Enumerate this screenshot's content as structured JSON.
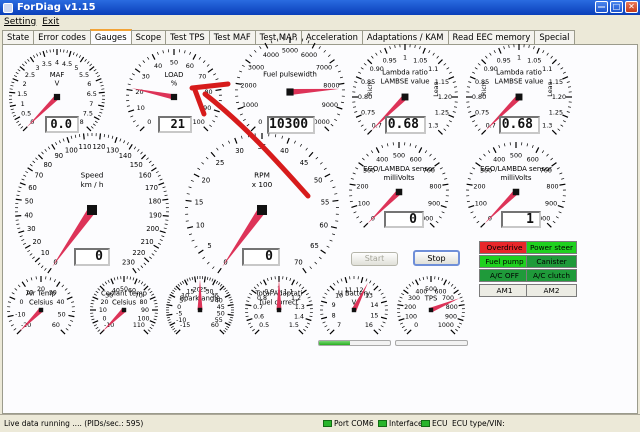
{
  "window": {
    "title": "ForDiag v1.15"
  },
  "menu": [
    "Setting",
    "Exit"
  ],
  "tabs": [
    "State",
    "Error codes",
    "Gauges",
    "Scope",
    "Test TPS",
    "Test MAF",
    "Test MAP",
    "Acceleration",
    "Adaptations / KAM",
    "Read EEC memory",
    "Special"
  ],
  "active_tab": "Gauges",
  "colors": {
    "needle": "#dd3358",
    "tab_accent": "#f2a336",
    "led_on": "#29b52b",
    "annotation_arrow": "#d71b1b"
  },
  "gauges": [
    {
      "title": [
        "MAF",
        "V"
      ],
      "labels": [
        "0",
        "0.5",
        "1",
        "1.5",
        "2",
        "2.5",
        "3",
        "3.5",
        "4",
        "4.5",
        "5",
        "5.5",
        "6",
        "6.5",
        "7",
        "7.5",
        "8"
      ],
      "readout": "0.0",
      "level": 0.0
    },
    {
      "title": [
        "LOAD",
        "%"
      ],
      "labels": [
        "0",
        "10",
        "20",
        "30",
        "40",
        "50",
        "60",
        "70",
        "80",
        "90",
        "100"
      ],
      "readout": "21",
      "level": 0.21
    },
    {
      "title": [
        "Fuel pulsewidth"
      ],
      "labels": [
        "0",
        "1000",
        "2000",
        "3000",
        "4000",
        "5000",
        "6000",
        "7000",
        "8000",
        "9000",
        "10000"
      ],
      "readout": "10300",
      "level": 0.82
    },
    {
      "title": [
        "Lambda ratio",
        "LAMBSE value"
      ],
      "labels": [
        "0.7",
        "0.75",
        "0.80",
        "0.85",
        "0.90",
        "0.95",
        "1",
        "1.05",
        "1.1",
        "1.15",
        "1.20",
        "1.25",
        "1.3"
      ],
      "side_left": "Rich",
      "side_right": "Lean",
      "readout": "0.68",
      "level": 0.0
    },
    {
      "title": [
        "Lambda ratio",
        "LAMBSE value"
      ],
      "labels": [
        "0.7",
        "0.75",
        "0.80",
        "0.85",
        "0.90",
        "0.95",
        "1",
        "1.05",
        "1.1",
        "1.15",
        "1.20",
        "1.25",
        "1.3"
      ],
      "side_left": "Rich",
      "side_right": "Lean",
      "readout": "0.68",
      "level": 0.0
    },
    {
      "title": [
        "Speed",
        "km / h"
      ],
      "labels": [
        "0",
        "10",
        "20",
        "30",
        "40",
        "50",
        "60",
        "70",
        "80",
        "90",
        "100",
        "110",
        "120",
        "130",
        "140",
        "150",
        "160",
        "170",
        "180",
        "190",
        "200",
        "210",
        "220",
        "230"
      ],
      "readout": "0",
      "level": 0.0
    },
    {
      "title": [
        "RPM",
        "x 100"
      ],
      "labels": [
        "0",
        "5",
        "10",
        "15",
        "20",
        "25",
        "30",
        "35",
        "40",
        "45",
        "50",
        "55",
        "60",
        "65",
        "70"
      ],
      "readout": "0",
      "level": 0.0
    },
    {
      "title": [
        "EGO/LAMBDA sensor",
        "milliVolts"
      ],
      "labels": [
        "0",
        "100",
        "200",
        "300",
        "400",
        "500",
        "600",
        "700",
        "800",
        "900",
        "1000"
      ],
      "readout": "0",
      "level": 0.0
    },
    {
      "title": [
        "EGO/LAMBDA sensor",
        "milliVolts"
      ],
      "labels": [
        "0",
        "100",
        "200",
        "300",
        "400",
        "500",
        "600",
        "700",
        "800",
        "900",
        "1000"
      ],
      "readout": "1",
      "level": 0.0
    },
    {
      "title": [
        "Air Temp",
        "Celsius"
      ],
      "labels": [
        "-20",
        "-10",
        "0",
        "10",
        "20",
        "30",
        "40",
        "50",
        "60"
      ],
      "level": 0.0
    },
    {
      "title": [
        "Coolant temp",
        "Celsius"
      ],
      "labels": [
        "-10",
        "0",
        "10",
        "20",
        "30",
        "40",
        "50",
        "60",
        "70",
        "80",
        "90",
        "100",
        "110"
      ],
      "level": 0.0
    },
    {
      "title": [
        "Spark angle"
      ],
      "labels": [
        "-15",
        "-10",
        "-5",
        "0",
        "5",
        "10",
        "15",
        "20",
        "25",
        "30",
        "35",
        "40",
        "45",
        "50",
        "55",
        "60"
      ],
      "level": 0.5
    },
    {
      "title": [
        "Total Adaptati",
        "fuel correct"
      ],
      "labels": [
        "0.5",
        "0.6",
        "0.7",
        "0.8",
        "0.9",
        "1",
        "1.1",
        "1.2",
        "1.3",
        "1.4",
        "1.5"
      ],
      "level": 0.5
    },
    {
      "title": [
        "U Battery",
        "V"
      ],
      "labels": [
        "7",
        "8",
        "9",
        "10",
        "11",
        "12",
        "13",
        "14",
        "15",
        "16"
      ],
      "level": 0.6
    },
    {
      "title": [
        "TPS"
      ],
      "labels": [
        "0",
        "100",
        "200",
        "300",
        "400",
        "500",
        "600",
        "700",
        "800",
        "900",
        "1000"
      ],
      "level": 0.75
    }
  ],
  "controls": {
    "start": "Start",
    "stop": "Stop"
  },
  "status_indicators": [
    {
      "label": "Overdrive",
      "color": "#e8262a"
    },
    {
      "label": "Power steer",
      "color": "#1fd11f"
    },
    {
      "label": "Fuel pump",
      "color": "#1fd11f"
    },
    {
      "label": "Canister purge",
      "color": "#1f9a3a"
    },
    {
      "label": "A/C OFF",
      "color": "#1f9a3a"
    },
    {
      "label": "A/C clutch",
      "color": "#1f9a3a"
    },
    {
      "label": "AM1",
      "color": "#ecece4"
    },
    {
      "label": "AM2",
      "color": "#ecece4"
    }
  ],
  "progress_bars": [
    0.44,
    0.0
  ],
  "status_bar": {
    "text": "Live data running .... (PIDs/sec.: 595)",
    "port": "Port COM6",
    "interface": "Interface",
    "ecu": "ECU",
    "ecu_type": "ECU type/VIN:"
  }
}
